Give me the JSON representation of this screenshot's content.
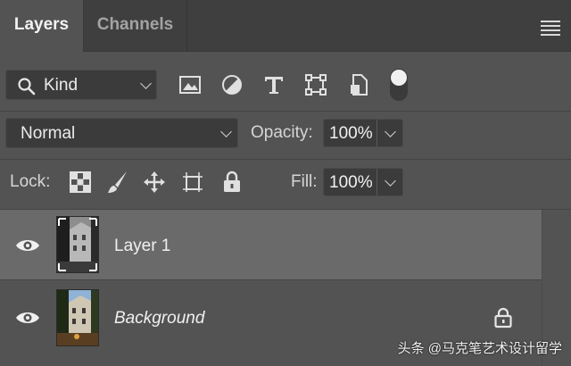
{
  "tabs": [
    {
      "label": "Layers",
      "active": true
    },
    {
      "label": "Channels",
      "active": false
    }
  ],
  "filter": {
    "kind_label": "Kind",
    "icons": [
      "image-filter-icon",
      "adjustment-filter-icon",
      "type-filter-icon",
      "shape-filter-icon",
      "smart-object-filter-icon"
    ]
  },
  "blend": {
    "mode": "Normal",
    "opacity_label": "Opacity:",
    "opacity_value": "100%"
  },
  "lock": {
    "label": "Lock:",
    "fill_label": "Fill:",
    "fill_value": "100%"
  },
  "layers": [
    {
      "name": "Layer 1",
      "visible": true,
      "selected": true,
      "locked": false
    },
    {
      "name": "Background",
      "visible": true,
      "selected": false,
      "locked": true
    }
  ],
  "watermark": "头条 @马克笔艺术设计留学",
  "colors": {
    "panel": "#535353",
    "tabbar": "#3f3f3f",
    "selected_row": "#6a6a6a",
    "field": "#3b3b3b"
  }
}
